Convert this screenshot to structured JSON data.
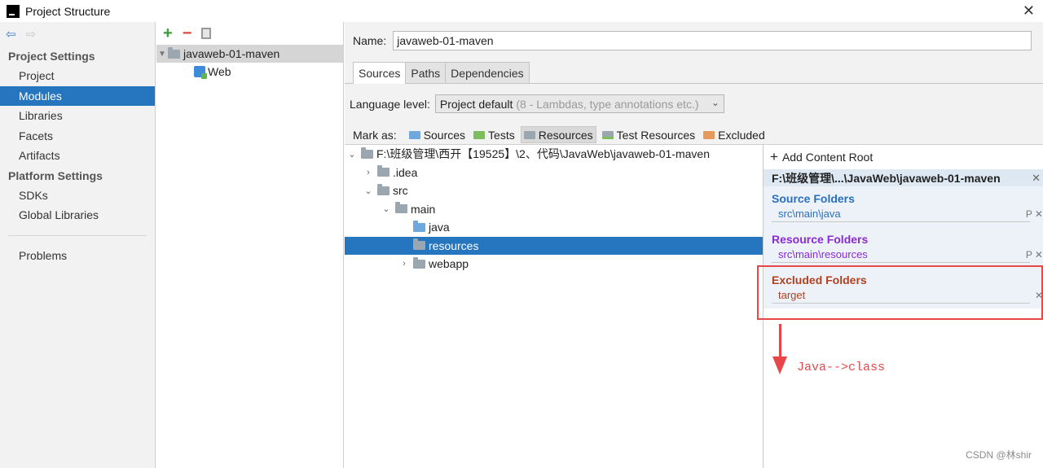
{
  "window": {
    "title": "Project Structure"
  },
  "leftnav": {
    "project_settings": "Project Settings",
    "project_items": [
      "Project",
      "Modules",
      "Libraries",
      "Facets",
      "Artifacts"
    ],
    "platform_settings": "Platform Settings",
    "platform_items": [
      "SDKs",
      "Global Libraries"
    ],
    "problems": "Problems",
    "selected": "Modules"
  },
  "modules": {
    "module_name": "javaweb-01-maven",
    "facet": "Web"
  },
  "main": {
    "name_label": "Name:",
    "name_value": "javaweb-01-maven",
    "tabs": [
      "Sources",
      "Paths",
      "Dependencies"
    ],
    "active_tab": "Sources",
    "language_level_label": "Language level:",
    "language_level_value": "Project default",
    "language_level_hint": "(8 - Lambdas, type annotations etc.)",
    "mark_as_label": "Mark as:",
    "mark_as": [
      "Sources",
      "Tests",
      "Resources",
      "Test Resources",
      "Excluded"
    ]
  },
  "filetree": {
    "root": "F:\\班级管理\\西开【19525】\\2、代码\\JavaWeb\\javaweb-01-maven",
    "idea": ".idea",
    "src": "src",
    "main": "main",
    "java": "java",
    "resources": "resources",
    "webapp": "webapp"
  },
  "content_root": {
    "add_label": "Add Content Root",
    "root_path": "F:\\班级管理\\...\\JavaWeb\\javaweb-01-maven",
    "source_folders_title": "Source Folders",
    "source_folder": "src\\main\\java",
    "resource_folders_title": "Resource Folders",
    "resource_folder": "src\\main\\resources",
    "excluded_folders_title": "Excluded Folders",
    "excluded_folder": "target"
  },
  "annotation": {
    "text": "Java-->class"
  },
  "watermark": "CSDN @林shir",
  "colors": {
    "selection": "#2675bf",
    "source": "#2a6fbf",
    "resource": "#8a2ad4",
    "excluded": "#b24020",
    "annotation": "#e8474a"
  }
}
